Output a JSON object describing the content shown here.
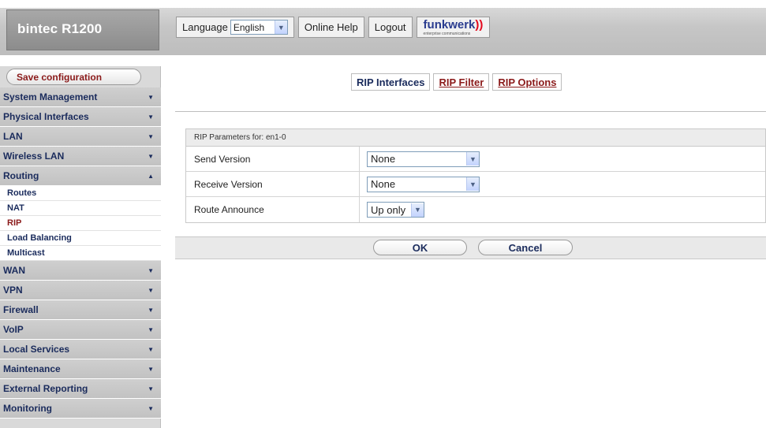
{
  "header": {
    "brand": "bintec R1200",
    "language_label": "Language",
    "language_value": "English",
    "online_help": "Online Help",
    "logout": "Logout",
    "logo_text": "funkwerk",
    "logo_sub": "enterprise communications"
  },
  "sidebar": {
    "save_label": "Save configuration",
    "items": [
      {
        "label": "System Management",
        "state": "collapsed"
      },
      {
        "label": "Physical Interfaces",
        "state": "collapsed"
      },
      {
        "label": "LAN",
        "state": "collapsed"
      },
      {
        "label": "Wireless LAN",
        "state": "collapsed"
      },
      {
        "label": "Routing",
        "state": "expanded"
      }
    ],
    "routing_sub": [
      "Routes",
      "NAT",
      "RIP",
      "Load Balancing",
      "Multicast"
    ],
    "routing_active": "RIP",
    "items_after": [
      {
        "label": "WAN"
      },
      {
        "label": "VPN"
      },
      {
        "label": "Firewall"
      },
      {
        "label": "VoIP"
      },
      {
        "label": "Local Services"
      },
      {
        "label": "Maintenance"
      },
      {
        "label": "External Reporting"
      },
      {
        "label": "Monitoring"
      }
    ]
  },
  "tabs": {
    "active": "RIP Interfaces",
    "filter": "RIP Filter",
    "options": "RIP Options"
  },
  "form": {
    "section_title": "RIP Parameters for: en1-0",
    "send_version_label": "Send Version",
    "send_version_value": "None",
    "receive_version_label": "Receive Version",
    "receive_version_value": "None",
    "route_announce_label": "Route Announce",
    "route_announce_value": "Up only"
  },
  "buttons": {
    "ok": "OK",
    "cancel": "Cancel"
  },
  "colors": {
    "link": "#8b1a1a",
    "nav_text": "#1a2b5c",
    "sidebar_bg": "#d9d9d9"
  }
}
